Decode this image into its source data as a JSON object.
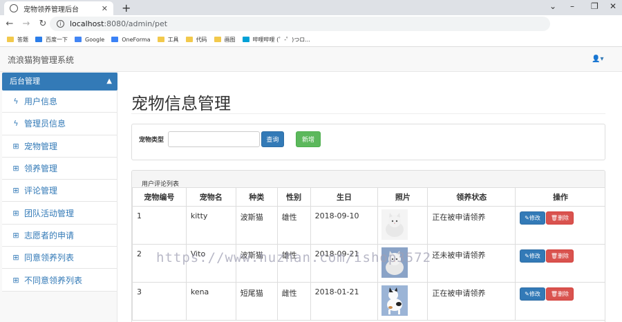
{
  "browser": {
    "tab_title": "宠物领养管理后台",
    "url_host": "localhost",
    "url_rest": ":8080/admin/pet",
    "bookmarks": [
      {
        "label": "答题",
        "color": "#f2c94c"
      },
      {
        "label": "百度一下",
        "color": "#2b7de9"
      },
      {
        "label": "Google",
        "color": "#4285f4"
      },
      {
        "label": "OneForma",
        "color": "#3b82f6"
      },
      {
        "label": "工具",
        "color": "#f2c94c"
      },
      {
        "label": "代码",
        "color": "#f2c94c"
      },
      {
        "label": "画图",
        "color": "#f2c94c"
      },
      {
        "label": "哔哩哔哩 (゜-゜)つロ...",
        "color": "#00a1d6"
      }
    ]
  },
  "app": {
    "brand": "流浪猫狗管理系统",
    "user_menu_caret": "▾"
  },
  "sidebar": {
    "header": "后台管理",
    "items": [
      {
        "label": "用户信息",
        "icon": "bolt-icon",
        "glyph": "ϟ"
      },
      {
        "label": "管理员信息",
        "icon": "bolt-icon",
        "glyph": "ϟ"
      },
      {
        "label": "宠物管理",
        "icon": "sitemap-icon",
        "glyph": "⊞"
      },
      {
        "label": "领养管理",
        "icon": "sitemap-icon",
        "glyph": "⊞"
      },
      {
        "label": "评论管理",
        "icon": "sitemap-icon",
        "glyph": "⊞"
      },
      {
        "label": "团队活动管理",
        "icon": "sitemap-icon",
        "glyph": "⊞"
      },
      {
        "label": "志愿者的申请",
        "icon": "sitemap-icon",
        "glyph": "⊞"
      },
      {
        "label": "同意领养列表",
        "icon": "sitemap-icon",
        "glyph": "⊞"
      },
      {
        "label": "不同意领养列表",
        "icon": "sitemap-icon",
        "glyph": "⊞"
      }
    ]
  },
  "main": {
    "title": "宠物信息管理",
    "filter": {
      "label": "宠物类型",
      "value": "",
      "query_button": "查询",
      "add_button": "新增"
    },
    "table": {
      "heading": "用户评论列表",
      "columns": [
        "宠物编号",
        "宠物名",
        "种类",
        "性别",
        "生日",
        "照片",
        "领养状态",
        "操作"
      ],
      "rows": [
        {
          "id": "1",
          "name": "kitty",
          "species": "波斯猫",
          "gender": "雄性",
          "birthday": "2018-09-10",
          "status": "正在被申请领养",
          "photo": "white-persian-cat"
        },
        {
          "id": "2",
          "name": "Vito",
          "species": "波斯猫",
          "gender": "雄性",
          "birthday": "2018-09-21",
          "status": "还未被申请领养",
          "photo": "white-persian-cat-blue-bg"
        },
        {
          "id": "3",
          "name": "kena",
          "species": "短尾猫",
          "gender": "雌性",
          "birthday": "2018-01-21",
          "status": "正在被申请领养",
          "photo": "calico-bobtail-cat"
        }
      ],
      "edit_label": "✎修改",
      "delete_label": "🗑删除"
    }
  },
  "watermark": "https://www.huzhan.com/ishop3572"
}
